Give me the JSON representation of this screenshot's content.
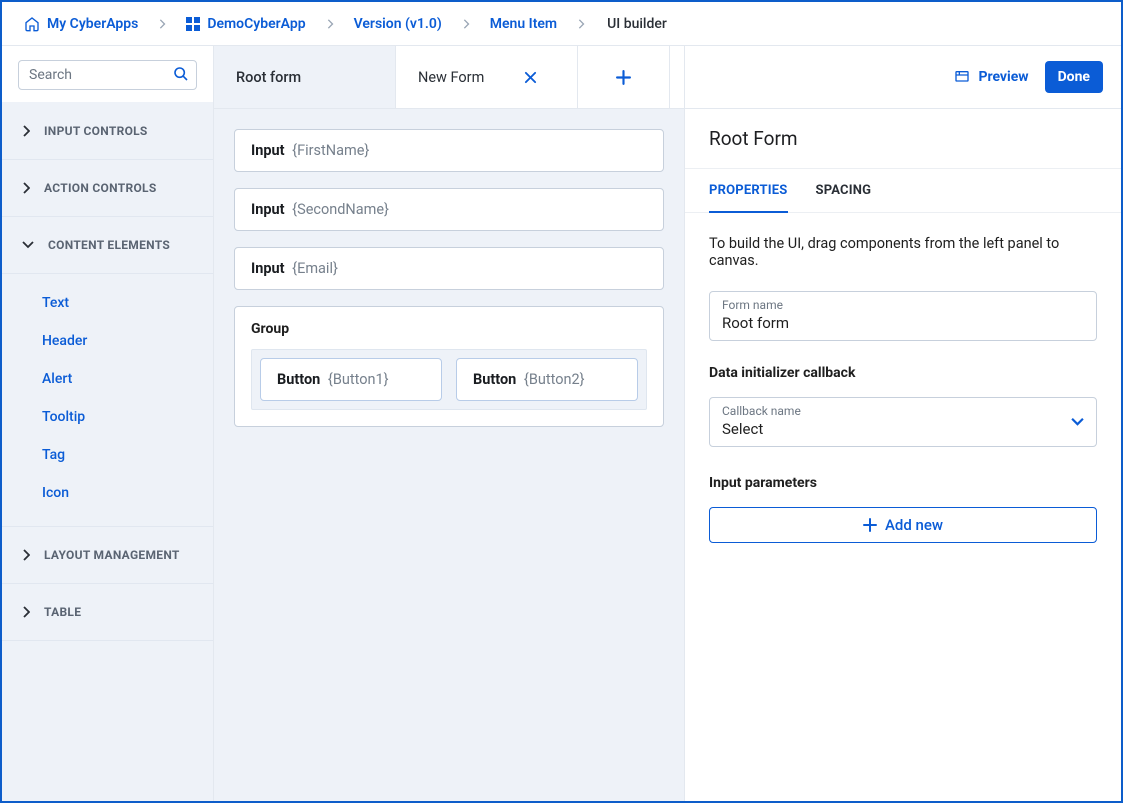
{
  "breadcrumb": {
    "home": "My CyberApps",
    "app": "DemoCyberApp",
    "version": "Version (v1.0)",
    "menu": "Menu Item",
    "current": "UI builder"
  },
  "sidebar": {
    "search_placeholder": "Search",
    "groups": [
      {
        "id": "input-controls",
        "label": "INPUT CONTROLS",
        "expanded": false,
        "items": []
      },
      {
        "id": "action-controls",
        "label": "ACTION CONTROLS",
        "expanded": false,
        "items": []
      },
      {
        "id": "content-elements",
        "label": "CONTENT ELEMENTS",
        "expanded": true,
        "items": [
          "Text",
          "Header",
          "Alert",
          "Tooltip",
          "Tag",
          "Icon"
        ]
      },
      {
        "id": "layout-management",
        "label": "LAYOUT MANAGEMENT",
        "expanded": false,
        "items": []
      },
      {
        "id": "table",
        "label": "TABLE",
        "expanded": false,
        "items": []
      }
    ]
  },
  "tabs": {
    "active": "Root form",
    "secondary": "New Form"
  },
  "actions": {
    "preview": "Preview",
    "done": "Done"
  },
  "canvas": {
    "blocks": [
      {
        "type": "Input",
        "param": "{FirstName}"
      },
      {
        "type": "Input",
        "param": "{SecondName}"
      },
      {
        "type": "Input",
        "param": "{Email}"
      }
    ],
    "group": {
      "label": "Group",
      "buttons": [
        {
          "type": "Button",
          "param": "{Button1}"
        },
        {
          "type": "Button",
          "param": "{Button2}"
        }
      ]
    }
  },
  "panel": {
    "title": "Root Form",
    "tabs": {
      "properties": "PROPERTIES",
      "spacing": "SPACING"
    },
    "hint": "To build the UI, drag components from the left panel to canvas.",
    "form_name_label": "Form name",
    "form_name_value": "Root form",
    "callback_section": "Data initializer callback",
    "callback_label": "Callback name",
    "callback_value": "Select",
    "params_section": "Input parameters",
    "add_new": "Add new"
  }
}
